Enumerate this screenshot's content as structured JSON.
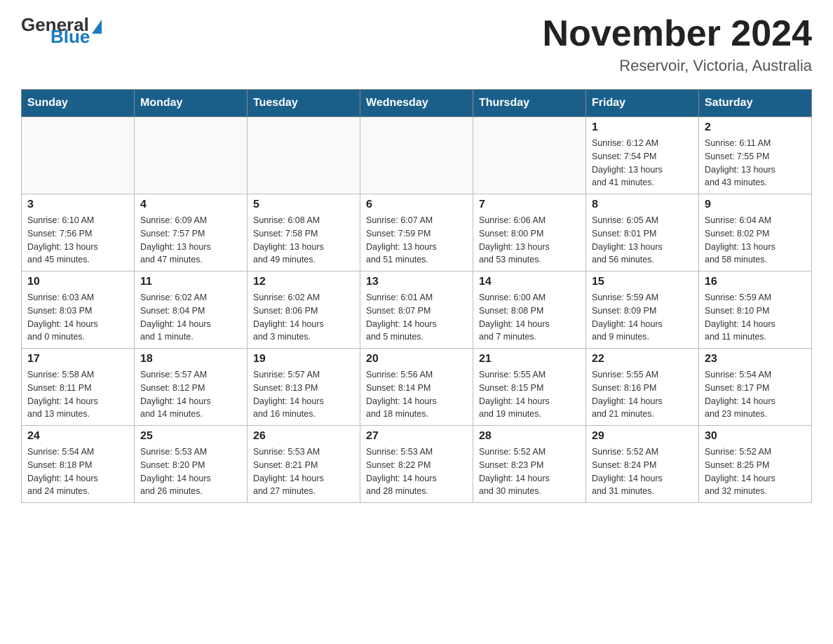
{
  "header": {
    "logo_general": "General",
    "logo_blue": "Blue",
    "month_title": "November 2024",
    "location": "Reservoir, Victoria, Australia"
  },
  "weekdays": [
    "Sunday",
    "Monday",
    "Tuesday",
    "Wednesday",
    "Thursday",
    "Friday",
    "Saturday"
  ],
  "weeks": [
    [
      {
        "day": "",
        "info": ""
      },
      {
        "day": "",
        "info": ""
      },
      {
        "day": "",
        "info": ""
      },
      {
        "day": "",
        "info": ""
      },
      {
        "day": "",
        "info": ""
      },
      {
        "day": "1",
        "info": "Sunrise: 6:12 AM\nSunset: 7:54 PM\nDaylight: 13 hours\nand 41 minutes."
      },
      {
        "day": "2",
        "info": "Sunrise: 6:11 AM\nSunset: 7:55 PM\nDaylight: 13 hours\nand 43 minutes."
      }
    ],
    [
      {
        "day": "3",
        "info": "Sunrise: 6:10 AM\nSunset: 7:56 PM\nDaylight: 13 hours\nand 45 minutes."
      },
      {
        "day": "4",
        "info": "Sunrise: 6:09 AM\nSunset: 7:57 PM\nDaylight: 13 hours\nand 47 minutes."
      },
      {
        "day": "5",
        "info": "Sunrise: 6:08 AM\nSunset: 7:58 PM\nDaylight: 13 hours\nand 49 minutes."
      },
      {
        "day": "6",
        "info": "Sunrise: 6:07 AM\nSunset: 7:59 PM\nDaylight: 13 hours\nand 51 minutes."
      },
      {
        "day": "7",
        "info": "Sunrise: 6:06 AM\nSunset: 8:00 PM\nDaylight: 13 hours\nand 53 minutes."
      },
      {
        "day": "8",
        "info": "Sunrise: 6:05 AM\nSunset: 8:01 PM\nDaylight: 13 hours\nand 56 minutes."
      },
      {
        "day": "9",
        "info": "Sunrise: 6:04 AM\nSunset: 8:02 PM\nDaylight: 13 hours\nand 58 minutes."
      }
    ],
    [
      {
        "day": "10",
        "info": "Sunrise: 6:03 AM\nSunset: 8:03 PM\nDaylight: 14 hours\nand 0 minutes."
      },
      {
        "day": "11",
        "info": "Sunrise: 6:02 AM\nSunset: 8:04 PM\nDaylight: 14 hours\nand 1 minute."
      },
      {
        "day": "12",
        "info": "Sunrise: 6:02 AM\nSunset: 8:06 PM\nDaylight: 14 hours\nand 3 minutes."
      },
      {
        "day": "13",
        "info": "Sunrise: 6:01 AM\nSunset: 8:07 PM\nDaylight: 14 hours\nand 5 minutes."
      },
      {
        "day": "14",
        "info": "Sunrise: 6:00 AM\nSunset: 8:08 PM\nDaylight: 14 hours\nand 7 minutes."
      },
      {
        "day": "15",
        "info": "Sunrise: 5:59 AM\nSunset: 8:09 PM\nDaylight: 14 hours\nand 9 minutes."
      },
      {
        "day": "16",
        "info": "Sunrise: 5:59 AM\nSunset: 8:10 PM\nDaylight: 14 hours\nand 11 minutes."
      }
    ],
    [
      {
        "day": "17",
        "info": "Sunrise: 5:58 AM\nSunset: 8:11 PM\nDaylight: 14 hours\nand 13 minutes."
      },
      {
        "day": "18",
        "info": "Sunrise: 5:57 AM\nSunset: 8:12 PM\nDaylight: 14 hours\nand 14 minutes."
      },
      {
        "day": "19",
        "info": "Sunrise: 5:57 AM\nSunset: 8:13 PM\nDaylight: 14 hours\nand 16 minutes."
      },
      {
        "day": "20",
        "info": "Sunrise: 5:56 AM\nSunset: 8:14 PM\nDaylight: 14 hours\nand 18 minutes."
      },
      {
        "day": "21",
        "info": "Sunrise: 5:55 AM\nSunset: 8:15 PM\nDaylight: 14 hours\nand 19 minutes."
      },
      {
        "day": "22",
        "info": "Sunrise: 5:55 AM\nSunset: 8:16 PM\nDaylight: 14 hours\nand 21 minutes."
      },
      {
        "day": "23",
        "info": "Sunrise: 5:54 AM\nSunset: 8:17 PM\nDaylight: 14 hours\nand 23 minutes."
      }
    ],
    [
      {
        "day": "24",
        "info": "Sunrise: 5:54 AM\nSunset: 8:18 PM\nDaylight: 14 hours\nand 24 minutes."
      },
      {
        "day": "25",
        "info": "Sunrise: 5:53 AM\nSunset: 8:20 PM\nDaylight: 14 hours\nand 26 minutes."
      },
      {
        "day": "26",
        "info": "Sunrise: 5:53 AM\nSunset: 8:21 PM\nDaylight: 14 hours\nand 27 minutes."
      },
      {
        "day": "27",
        "info": "Sunrise: 5:53 AM\nSunset: 8:22 PM\nDaylight: 14 hours\nand 28 minutes."
      },
      {
        "day": "28",
        "info": "Sunrise: 5:52 AM\nSunset: 8:23 PM\nDaylight: 14 hours\nand 30 minutes."
      },
      {
        "day": "29",
        "info": "Sunrise: 5:52 AM\nSunset: 8:24 PM\nDaylight: 14 hours\nand 31 minutes."
      },
      {
        "day": "30",
        "info": "Sunrise: 5:52 AM\nSunset: 8:25 PM\nDaylight: 14 hours\nand 32 minutes."
      }
    ]
  ]
}
